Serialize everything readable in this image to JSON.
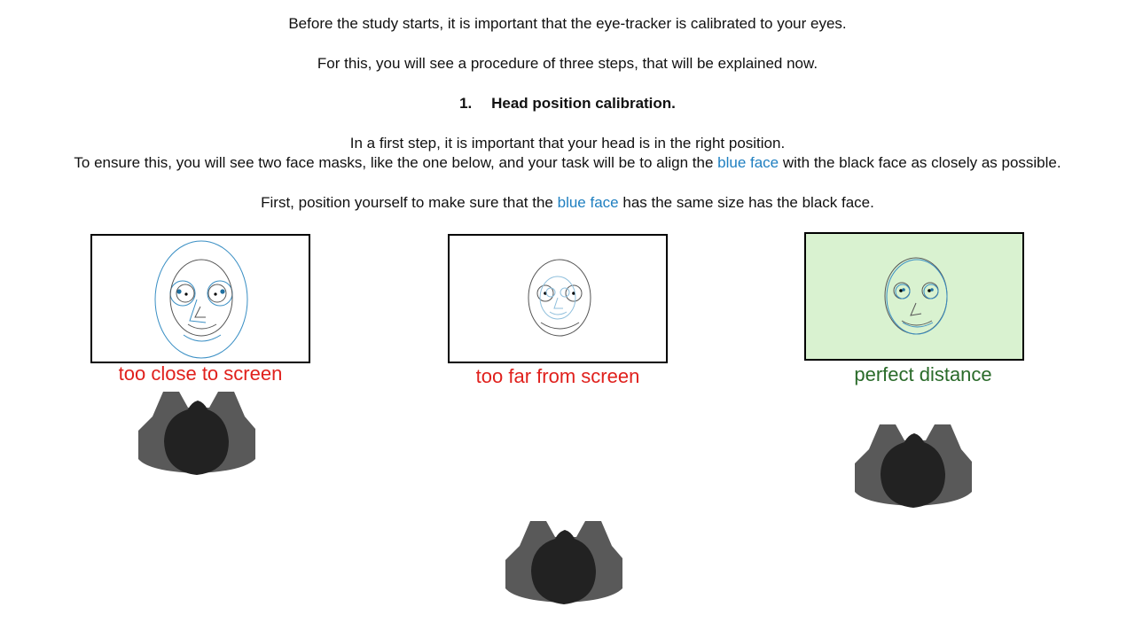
{
  "instructions": {
    "intro": "Before the study starts, it is important that the eye-tracker is calibrated to your eyes.",
    "procedure": "For this, you will see a procedure of three steps, that will be explained now.",
    "step_number": "1.",
    "step_title": "Head position calibration.",
    "first_step": "In a first step, it is important that your head is in the right position.",
    "ensure_pre": "To ensure this, you will see two face masks, like the one below, and your task will be to align the",
    "ensure_blue": "blue face",
    "ensure_post": "with the black face as closely as possible.",
    "size_pre": "First, position yourself to make sure that the",
    "size_blue": "blue face",
    "size_post": "has the same size has the black face."
  },
  "examples": [
    {
      "label": "too close to screen",
      "label_color": "#e0201c",
      "frame_bg": "#ffffff"
    },
    {
      "label": "too far from screen",
      "label_color": "#e0201c",
      "frame_bg": "#ffffff"
    },
    {
      "label": "perfect distance",
      "label_color": "#2a6b2a",
      "frame_bg": "#d9f2d0"
    }
  ],
  "colors": {
    "text": "#111111",
    "blue_face": "#3a8fc4",
    "black_face": "#555555",
    "person_body": "#595959",
    "person_head": "#222222"
  }
}
